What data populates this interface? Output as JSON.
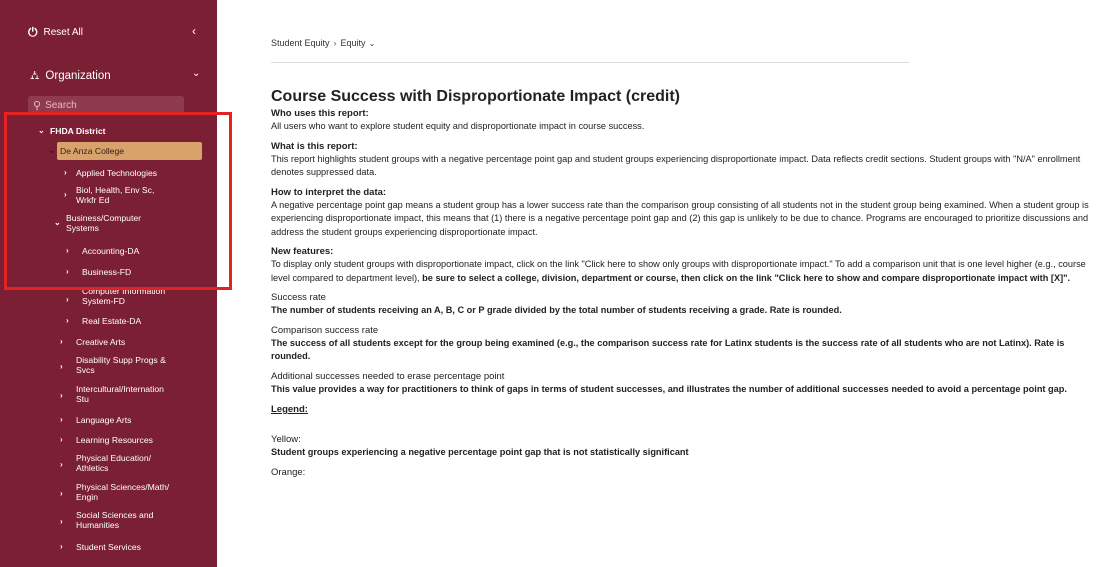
{
  "sidebar": {
    "reset_label": "Reset All",
    "org_label": "Organization",
    "search_placeholder": "Search",
    "tree": [
      {
        "label": "FHDA District",
        "chev": "⌄"
      },
      {
        "label": "De Anza College",
        "chev": "⌄"
      },
      {
        "label": "Applied Technologies",
        "chev": "›"
      },
      {
        "label": "Biol, Health, Env Sc,",
        "label2": "Wrkfr Ed",
        "chev": "›"
      },
      {
        "label": "Business/Computer",
        "label2": "Systems",
        "chev": "⌄"
      },
      {
        "label": "Accounting-DA",
        "chev": "›"
      },
      {
        "label": "Business-FD",
        "chev": "›"
      },
      {
        "label": "Computer Information",
        "label2": "System-FD",
        "chev": "›"
      },
      {
        "label": "Real Estate-DA",
        "chev": "›"
      },
      {
        "label": "Creative Arts",
        "chev": "›"
      },
      {
        "label": "Disability Supp Progs &",
        "label2": "Svcs",
        "chev": "›"
      },
      {
        "label": "Intercultural/Internation",
        "label2": "Stu",
        "chev": "›"
      },
      {
        "label": "Language Arts",
        "chev": "›"
      },
      {
        "label": "Learning Resources",
        "chev": "›"
      },
      {
        "label": "Physical Education/",
        "label2": "Athletics",
        "chev": "›"
      },
      {
        "label": "Physical Sciences/Math/",
        "label2": "Engin",
        "chev": "›"
      },
      {
        "label": "Social Sciences and",
        "label2": "Humanities",
        "chev": "›"
      },
      {
        "label": "Student Services",
        "chev": "›"
      }
    ]
  },
  "breadcrumb": {
    "parent": "Student Equity",
    "current": "Equity"
  },
  "report": {
    "title": "Course Success with Disproportionate Impact (credit)",
    "who_heading": "Who uses this report:",
    "who_text": "All users who want to explore student equity and disproportionate impact in course success.",
    "what_heading": "What is this report:",
    "what_text": "This report highlights student groups with a negative percentage point gap and student groups experiencing disproportionate impact. Data reflects credit sections. Student groups with \"N/A\" enrollment denotes suppressed data.",
    "how_heading": "How to interpret the data:",
    "how_text": "A negative percentage point gap means a student group has a lower success rate than the comparison group consisting of all students not in the student group being examined. When a student group is experiencing disproportionate impact, this means that (1) there is a negative percentage point gap and (2) this gap is unlikely to be due to chance. Programs are encouraged to prioritize discussions and address the student groups experiencing disproportionate impact.",
    "new_heading": "New features:",
    "new_text_a": "To display only student groups with disproportionate impact, click on the link \"Click here to show only groups with disproportionate impact.\" To add a comparison unit that is one level higher (e.g., course level compared to department level), ",
    "new_text_b": "be sure to select a college, division, department or course, then click on the link \"Click here to show and compare disproportionate impact with [X]\".",
    "success_heading": "Success rate",
    "success_text": "The number of students receiving an A, B, C or P grade divided by the total number of students receiving a grade. Rate is rounded.",
    "comp_heading": "Comparison success rate",
    "comp_text": "The success of all students except for the group being examined (e.g., the comparison success rate for Latinx students is the success rate of all students who are not Latinx). Rate is rounded.",
    "add_heading": "Additional successes needed to erase percentage point",
    "add_text": "This value provides a way for practitioners to think of gaps in terms of student successes, and illustrates the number of additional successes needed to avoid a percentage point gap.",
    "legend_label": "Legend:",
    "yellow_heading": "Yellow:",
    "yellow_text": "Student groups experiencing a negative percentage point gap that is not statistically significant",
    "orange_heading": "Orange:"
  },
  "colors": {
    "sidebar_bg": "#7b1f35",
    "selected_bg": "#d7a36b",
    "highlight_box": "#e52222"
  }
}
